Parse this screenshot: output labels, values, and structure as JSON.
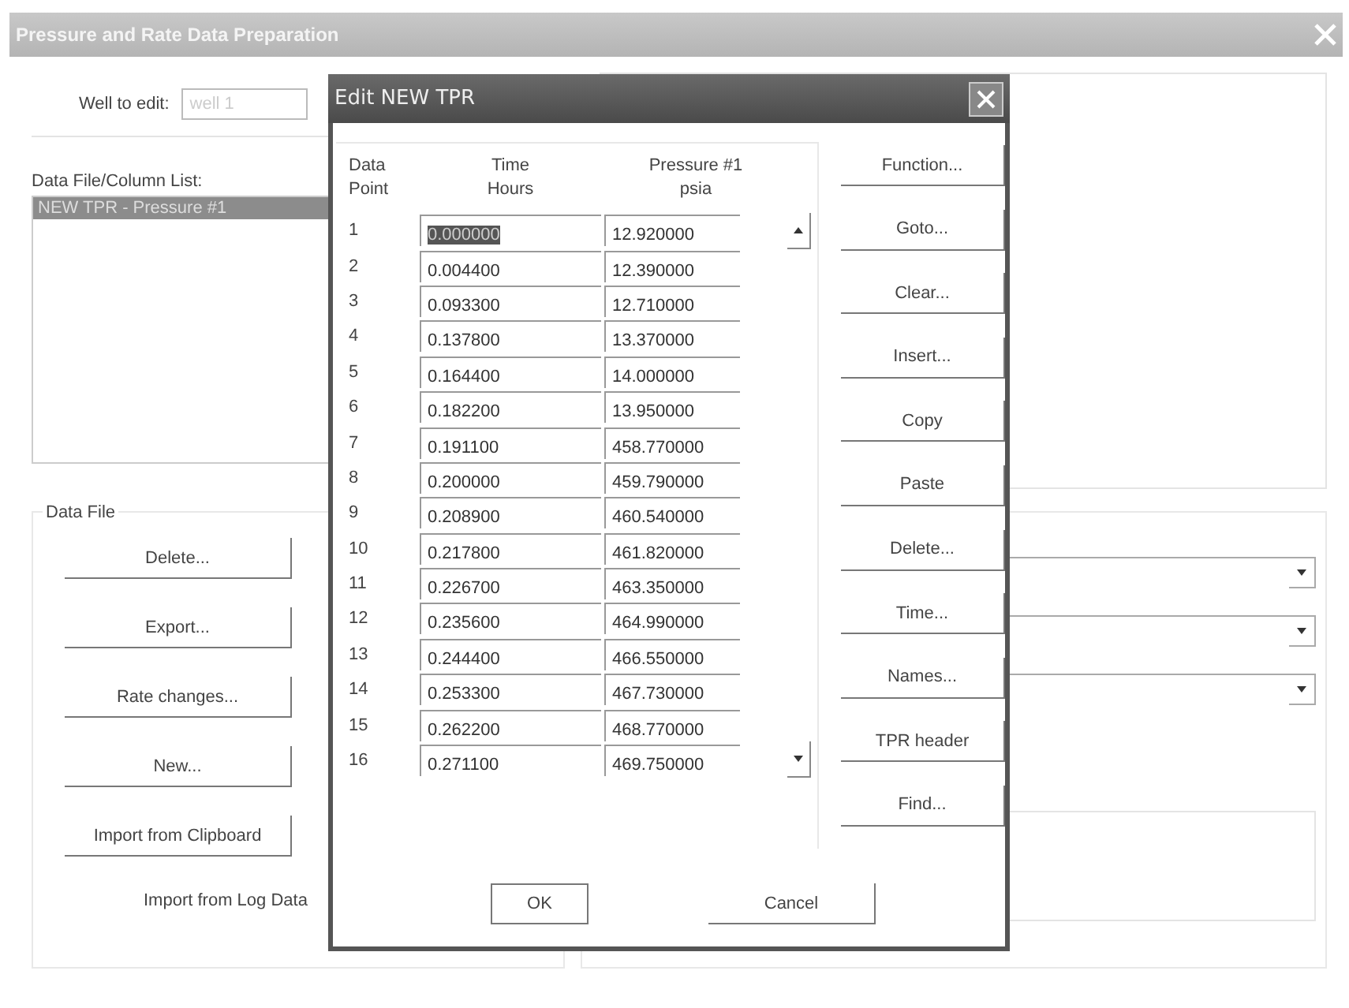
{
  "window": {
    "title": "Pressure and Rate Data Preparation"
  },
  "well": {
    "label": "Well to edit:",
    "value": "well 1",
    "disabled": true
  },
  "column_list": {
    "label": "Data File/Column List:",
    "items": [
      {
        "label": "NEW TPR - Pressure #1",
        "selected": true
      }
    ]
  },
  "data_file": {
    "label": "Data File",
    "buttons": [
      "Delete...",
      "Export...",
      "Rate changes...",
      "New...",
      "Import from Clipboard"
    ],
    "partial_button": "Import from Log Data"
  },
  "dialog": {
    "title": "Edit NEW TPR",
    "columns": [
      {
        "line1": "Data",
        "line2": "Point"
      },
      {
        "line1": "Time",
        "line2": "Hours"
      },
      {
        "line1": "Pressure #1",
        "line2": "psia"
      }
    ],
    "rows": [
      {
        "point": "1",
        "time": "0.000000",
        "pressure": "12.920000",
        "selected": true
      },
      {
        "point": "2",
        "time": "0.004400",
        "pressure": "12.390000",
        "selected": false
      },
      {
        "point": "3",
        "time": "0.093300",
        "pressure": "12.710000",
        "selected": false
      },
      {
        "point": "4",
        "time": "0.137800",
        "pressure": "13.370000",
        "selected": false
      },
      {
        "point": "5",
        "time": "0.164400",
        "pressure": "14.000000",
        "selected": false
      },
      {
        "point": "6",
        "time": "0.182200",
        "pressure": "13.950000",
        "selected": false
      },
      {
        "point": "7",
        "time": "0.191100",
        "pressure": "458.770000",
        "selected": false
      },
      {
        "point": "8",
        "time": "0.200000",
        "pressure": "459.790000",
        "selected": false
      },
      {
        "point": "9",
        "time": "0.208900",
        "pressure": "460.540000",
        "selected": false
      },
      {
        "point": "10",
        "time": "0.217800",
        "pressure": "461.820000",
        "selected": false
      },
      {
        "point": "11",
        "time": "0.226700",
        "pressure": "463.350000",
        "selected": false
      },
      {
        "point": "12",
        "time": "0.235600",
        "pressure": "464.990000",
        "selected": false
      },
      {
        "point": "13",
        "time": "0.244400",
        "pressure": "466.550000",
        "selected": false
      },
      {
        "point": "14",
        "time": "0.253300",
        "pressure": "467.730000",
        "selected": false
      },
      {
        "point": "15",
        "time": "0.262200",
        "pressure": "468.770000",
        "selected": false
      },
      {
        "point": "16",
        "time": "0.271100",
        "pressure": "469.750000",
        "selected": false
      }
    ],
    "side_buttons": [
      "Function...",
      "Goto...",
      "Clear...",
      "Insert...",
      "Copy",
      "Paste",
      "Delete...",
      "Time...",
      "Names...",
      "TPR header",
      "Find..."
    ],
    "buttons": [
      "OK",
      "Cancel"
    ]
  }
}
